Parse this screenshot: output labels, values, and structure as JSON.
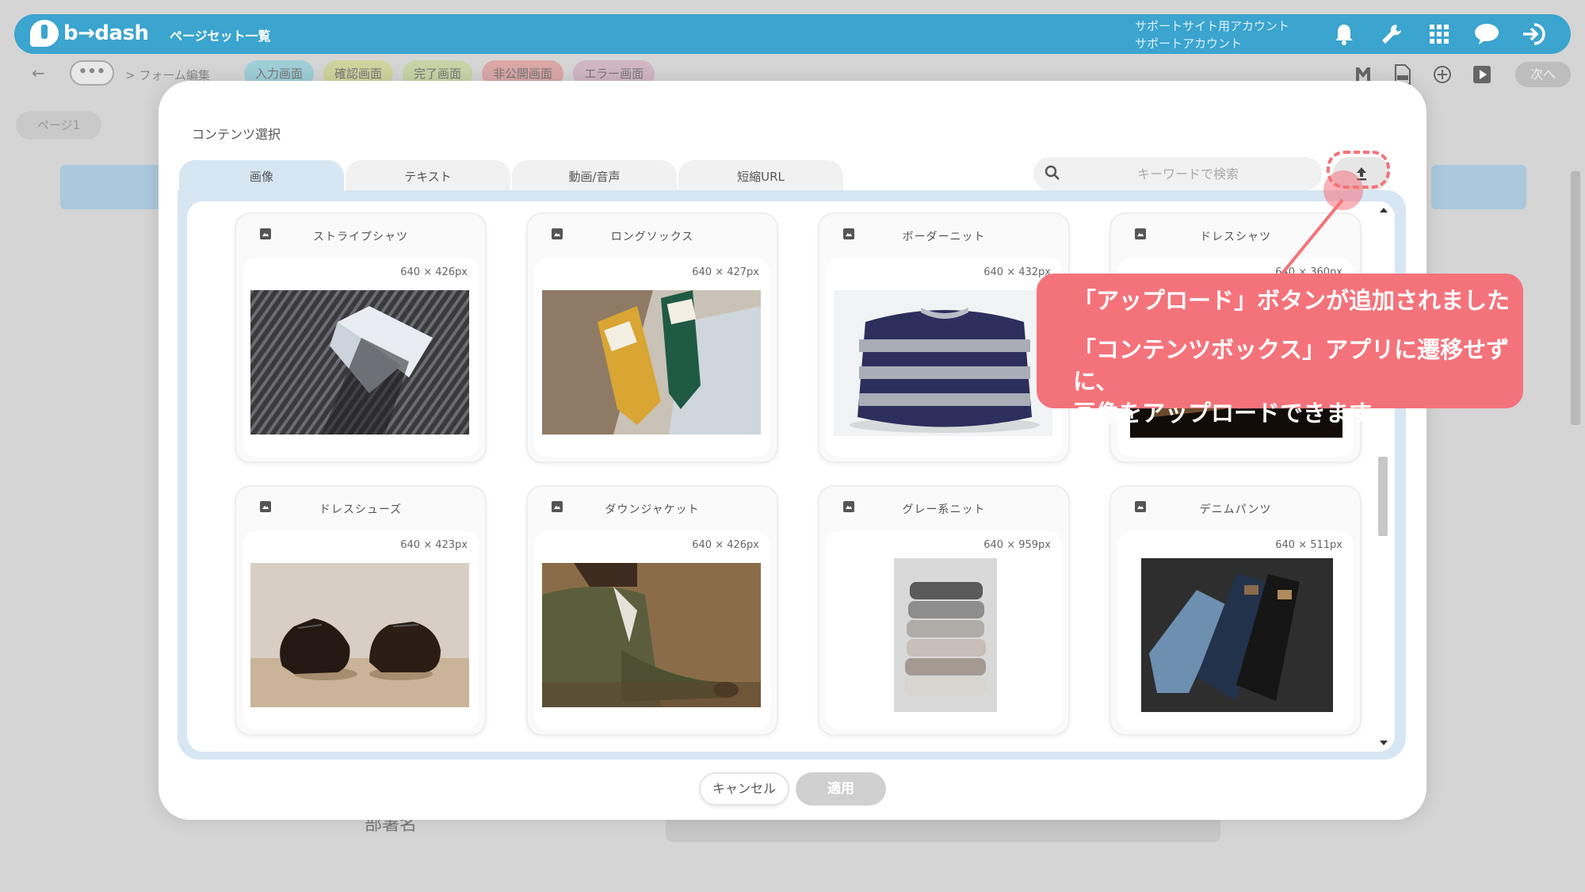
{
  "app": {
    "logo_text": "b→dash",
    "header_title": "ページセット一覧",
    "account_line1": "サポートサイト用アカウント",
    "account_line2": "サポートアカウント",
    "header_icons": [
      "bell-icon",
      "wrench-icon",
      "grid-icon",
      "chat-icon",
      "logout-icon"
    ]
  },
  "subbar": {
    "back": "←",
    "more": "•••",
    "breadcrumb": "> フォーム編集",
    "stages": [
      "入力画面",
      "確認画面",
      "完了画面",
      "非公開画面",
      "エラー画面"
    ],
    "next_label": "次へ"
  },
  "page_chip": "ページ1",
  "background_field_label": "部署名",
  "modal": {
    "title": "コンテンツ選択",
    "tabs": [
      "画像",
      "テキスト",
      "動画/音声",
      "短縮URL"
    ],
    "active_tab": 0,
    "search_placeholder": "キーワードで検索",
    "items": [
      {
        "name": "ストライプシャツ",
        "size": "640 × 426px"
      },
      {
        "name": "ロングソックス",
        "size": "640 × 427px"
      },
      {
        "name": "ボーダーニット",
        "size": "640 × 432px"
      },
      {
        "name": "ドレスシャツ",
        "size": "640 × 360px"
      },
      {
        "name": "ドレスシューズ",
        "size": "640 × 423px"
      },
      {
        "name": "ダウンジャケット",
        "size": "640 × 426px"
      },
      {
        "name": "グレー系ニット",
        "size": "640 × 959px"
      },
      {
        "name": "デニムパンツ",
        "size": "640 × 511px"
      }
    ],
    "cancel_label": "キャンセル",
    "apply_label": "適用"
  },
  "callout": {
    "line1": "「アップロード」ボタンが追加されました",
    "line2": "「コンテンツボックス」アプリに遷移せずに、",
    "line3": "画像をアップロードできます"
  },
  "colors": {
    "header": "#3ba4cf",
    "tab_active": "#d6e6f3",
    "callout": "#f4737b"
  }
}
